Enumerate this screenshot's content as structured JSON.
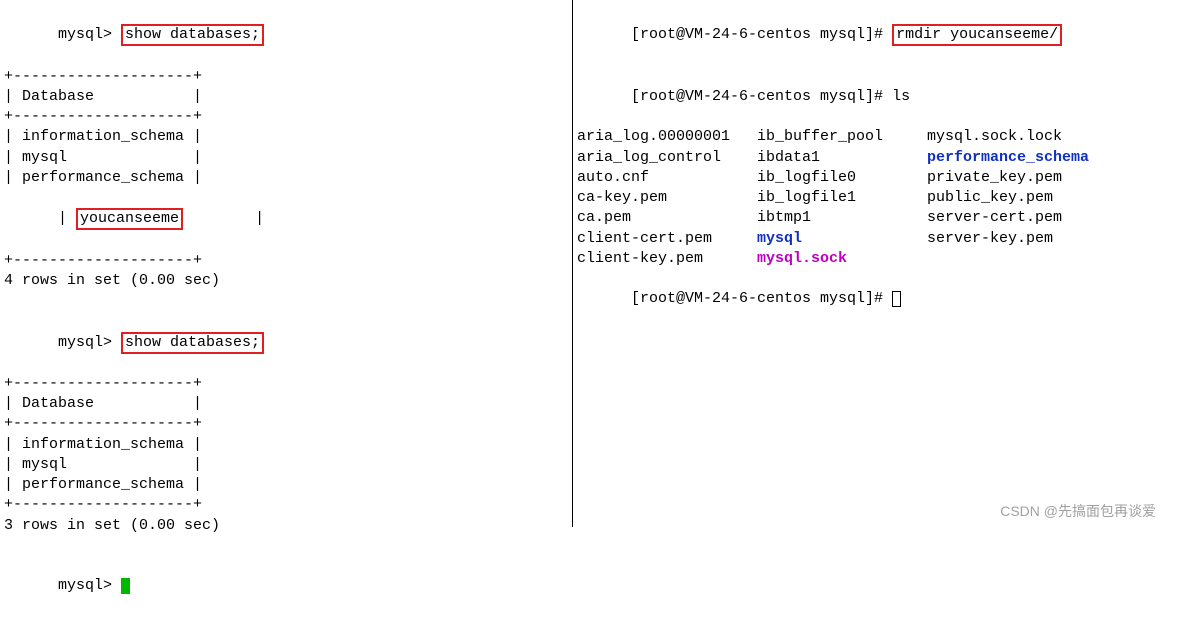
{
  "left": {
    "prompt": "mysql> ",
    "cmd1": "show databases;",
    "sep_top": "+--------------------+",
    "header_row": "| Database           |",
    "rows1": [
      "| information_schema |",
      "| mysql              |",
      "| performance_schema |"
    ],
    "row1_you_prefix": "| ",
    "row1_you": "youcanseeme",
    "row1_you_suffix": "        |",
    "result1": "4 rows in set (0.00 sec)",
    "cmd2": "show databases;",
    "rows2": [
      "| information_schema |",
      "| mysql              |",
      "| performance_schema |"
    ],
    "result2": "3 rows in set (0.00 sec)"
  },
  "right": {
    "shell_prompt": "[root@VM-24-6-centos mysql]# ",
    "cmd_rmdir": "rmdir youcanseeme/",
    "cmd_ls": "ls",
    "ls_files": [
      [
        "aria_log.00000001",
        "ib_buffer_pool",
        "mysql.sock.lock"
      ],
      [
        "aria_log_control",
        "ibdata1",
        "performance_schema"
      ],
      [
        "auto.cnf",
        "ib_logfile0",
        "private_key.pem"
      ],
      [
        "ca-key.pem",
        "ib_logfile1",
        "public_key.pem"
      ],
      [
        "ca.pem",
        "ibtmp1",
        "server-cert.pem"
      ],
      [
        "client-cert.pem",
        "mysql",
        "server-key.pem"
      ],
      [
        "client-key.pem",
        "mysql.sock",
        ""
      ]
    ]
  },
  "watermark": "CSDN @先搞面包再谈爱"
}
